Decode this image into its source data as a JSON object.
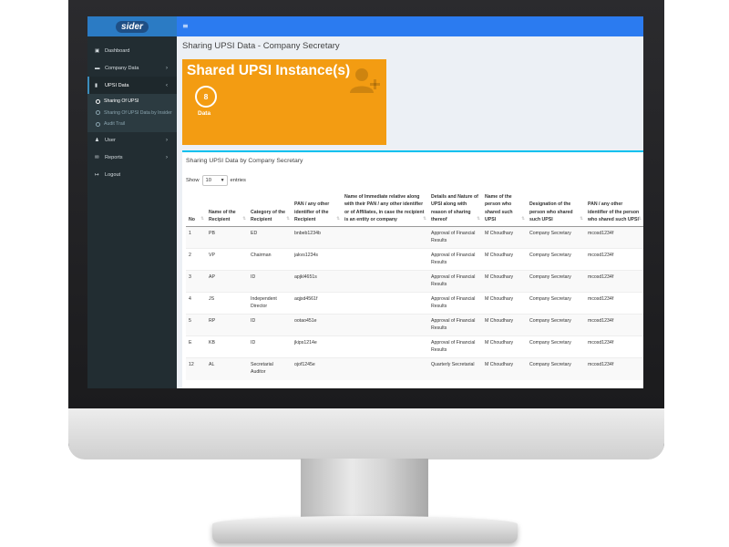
{
  "app": {
    "logo_text": "sider"
  },
  "topbar": {
    "menu_icon": "hamburger-icon",
    "menu_glyph": "≡"
  },
  "sidebar": {
    "items": [
      {
        "label": "Dashboard",
        "icon": "dashboard-icon",
        "glyph": "▣"
      },
      {
        "label": "Company Data",
        "icon": "folder-icon",
        "glyph": "▬",
        "chevron": "›"
      },
      {
        "label": "UPSI Data",
        "icon": "file-icon",
        "glyph": "▮",
        "chevron": "‹"
      },
      {
        "label": "User",
        "icon": "user-icon",
        "glyph": "♟",
        "chevron": "›"
      },
      {
        "label": "Reports",
        "icon": "envelope-icon",
        "glyph": "✉",
        "chevron": "›"
      },
      {
        "label": "Logout",
        "icon": "logout-icon",
        "glyph": "↦"
      }
    ],
    "submenu": [
      {
        "label": "Sharing Of UPSI"
      },
      {
        "label": "Sharing Of UPSI Data by Insider"
      },
      {
        "label": "Audit Trail"
      }
    ]
  },
  "page": {
    "title": "Sharing UPSI Data - Company Secretary"
  },
  "stat": {
    "title": "Shared UPSI Instance(s)",
    "value": "8",
    "label": "Data",
    "icon": "user-plus-icon",
    "color": "#f39c12"
  },
  "panel": {
    "title": "Sharing UPSI Data by Company Secretary",
    "show_label": "Show",
    "entries_value": "10",
    "entries_label": "entries"
  },
  "table": {
    "columns": [
      "No",
      "Name of the Recipient",
      "Category of the Recipient",
      "PAN / any other identifier of the Recipient",
      "Name of Immediate relative along with their PAN / any other identifier or of Affiliates, in case the recipient is an entity or company",
      "Details and Nature of UPSI along with reason of sharing thereof",
      "Name of the person who shared such UPSI",
      "Designation of the person who shared such UPSI",
      "PAN / any other identifier of the person who shared such UPSI"
    ],
    "rows": [
      [
        "1",
        "PB",
        "ED",
        "bnbeb1234b",
        "",
        "Approval of Financial Results",
        "M Choudhary",
        "Company Secretary",
        "mcosd1234f"
      ],
      [
        "2",
        "VP",
        "Chairman",
        "jakvs1234s",
        "",
        "Approval of Financial Results",
        "M Choudhary",
        "Company Secretary",
        "mcosd1234f"
      ],
      [
        "3",
        "AP",
        "ID",
        "apjkl4651s",
        "",
        "Approval of Financial Results",
        "M Choudhary",
        "Company Secretary",
        "mcosd1234f"
      ],
      [
        "4",
        "JS",
        "Independent Director",
        "aqjsd4561f",
        "",
        "Approval of Financial Results",
        "M Choudhary",
        "Company Secretary",
        "mcosd1234f"
      ],
      [
        "5",
        "RP",
        "ID",
        "ootao451e",
        "",
        "Approval of Financial Results",
        "M Choudhary",
        "Company Secretary",
        "mcosd1234f"
      ],
      [
        "E",
        "KB",
        "ID",
        "jkips1214e",
        "",
        "Approval of Financial Results",
        "M Choudhary",
        "Company Secretary",
        "mcosd1234f"
      ],
      [
        "12",
        "AL",
        "Secretarial Auditor",
        "ojof1245e",
        "",
        "Quarterly Secretarial",
        "M Choudhary",
        "Company Secretary",
        "mcosd1234f"
      ]
    ]
  }
}
